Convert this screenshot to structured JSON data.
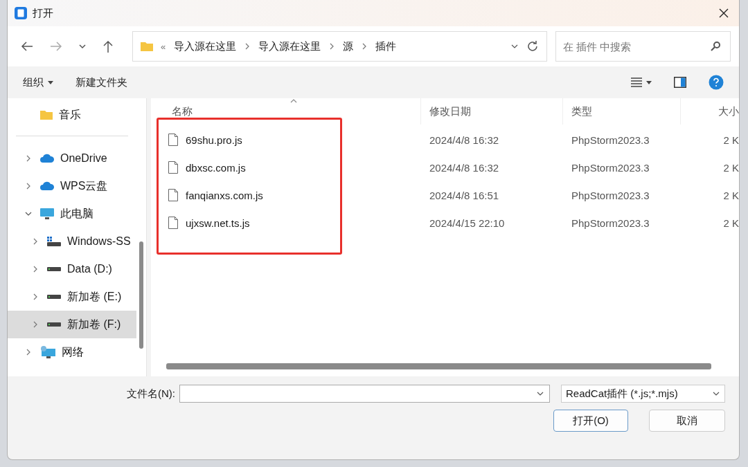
{
  "window": {
    "title": "打开"
  },
  "address_bar": {
    "overflow": "«",
    "crumbs": [
      "导入源在这里",
      "导入源在这里",
      "源",
      "插件"
    ]
  },
  "search": {
    "placeholder": "在 插件 中搜索"
  },
  "toolbar": {
    "organize": "组织",
    "new_folder": "新建文件夹"
  },
  "sidebar": {
    "items": [
      {
        "label": "音乐",
        "kind": "folder",
        "selected": false,
        "divider_after": true
      },
      {
        "label": "OneDrive",
        "kind": "cloud",
        "selected": false,
        "expanded": false
      },
      {
        "label": "WPS云盘",
        "kind": "cloud",
        "selected": false,
        "expanded": false
      },
      {
        "label": "此电脑",
        "kind": "computer",
        "selected": false,
        "expanded": true,
        "children": [
          {
            "label": "Windows-SS",
            "kind": "system-drive",
            "selected": false,
            "expanded": false
          },
          {
            "label": "Data (D:)",
            "kind": "drive",
            "selected": false,
            "expanded": false
          },
          {
            "label": "新加卷 (E:)",
            "kind": "drive",
            "selected": false,
            "expanded": false
          },
          {
            "label": "新加卷 (F:)",
            "kind": "drive",
            "selected": true,
            "expanded": false
          }
        ]
      },
      {
        "label": "网络",
        "kind": "network",
        "selected": false,
        "expanded": false
      }
    ]
  },
  "table": {
    "columns": [
      "名称",
      "修改日期",
      "类型",
      "大小"
    ],
    "rows": [
      {
        "name": "69shu.pro.js",
        "modified": "2024/4/8 16:32",
        "type": "PhpStorm2023.3",
        "size": "2 K"
      },
      {
        "name": "dbxsc.com.js",
        "modified": "2024/4/8 16:32",
        "type": "PhpStorm2023.3",
        "size": "2 K"
      },
      {
        "name": "fanqianxs.com.js",
        "modified": "2024/4/8 16:51",
        "type": "PhpStorm2023.3",
        "size": "2 K"
      },
      {
        "name": "ujxsw.net.ts.js",
        "modified": "2024/4/15 22:10",
        "type": "PhpStorm2023.3",
        "size": "2 K"
      }
    ],
    "highlight_box": true
  },
  "footer": {
    "filename_label": "文件名(N):",
    "filter": "ReadCat插件 (*.js;*.mjs)",
    "open_button": "打开(O)",
    "cancel_button": "取消"
  }
}
